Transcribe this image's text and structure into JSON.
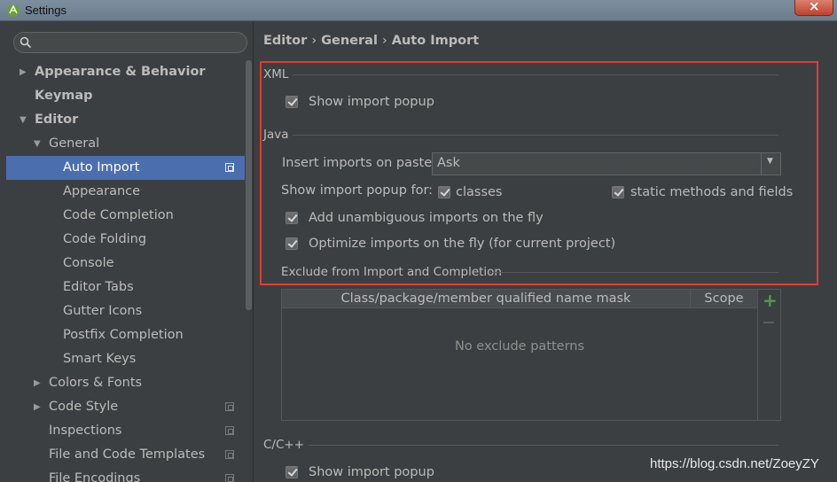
{
  "window": {
    "title": "Settings"
  },
  "search": {
    "value": "",
    "placeholder": ""
  },
  "sidebar": {
    "items": [
      {
        "label": "Appearance & Behavior"
      },
      {
        "label": "Keymap"
      },
      {
        "label": "Editor"
      },
      {
        "label": "General"
      },
      {
        "label": "Auto Import"
      },
      {
        "label": "Appearance"
      },
      {
        "label": "Code Completion"
      },
      {
        "label": "Code Folding"
      },
      {
        "label": "Console"
      },
      {
        "label": "Editor Tabs"
      },
      {
        "label": "Gutter Icons"
      },
      {
        "label": "Postfix Completion"
      },
      {
        "label": "Smart Keys"
      },
      {
        "label": "Colors & Fonts"
      },
      {
        "label": "Code Style"
      },
      {
        "label": "Inspections"
      },
      {
        "label": "File and Code Templates"
      },
      {
        "label": "File Encodings"
      }
    ]
  },
  "breadcrumb": {
    "part1": "Editor",
    "part2": "General",
    "part3": "Auto Import",
    "separator": "›"
  },
  "xml": {
    "title": "XML",
    "show_popup": "Show import popup"
  },
  "java": {
    "title": "Java",
    "insert_label": "Insert imports on paste:",
    "insert_value": "Ask",
    "popup_for_label": "Show import popup for:",
    "classes": "classes",
    "static": "static methods and fields",
    "add_unambiguous": "Add unambiguous imports on the fly",
    "optimize": "Optimize imports on the fly (for current project)",
    "exclude_title": "Exclude from Import and Completion"
  },
  "exclude_table": {
    "columns": [
      "Class/package/member qualified name mask",
      "Scope"
    ],
    "empty": "No exclude patterns",
    "add": "+"
  },
  "cpp": {
    "title": "C/C++",
    "show_popup": "Show import popup"
  },
  "watermark": "https://blog.csdn.net/ZoeyZY",
  "colors": {
    "selection": "#4b6eaf",
    "highlight": "#e03c31",
    "background": "#3c3f41"
  }
}
